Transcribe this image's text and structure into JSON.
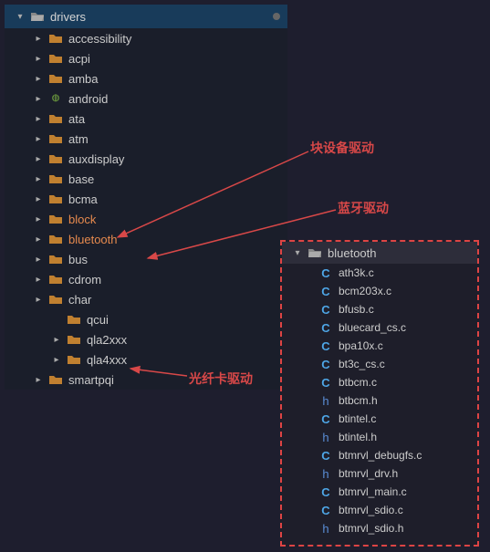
{
  "tree": {
    "root": "drivers",
    "items": [
      {
        "label": "accessibility",
        "icon": "folder"
      },
      {
        "label": "acpi",
        "icon": "folder"
      },
      {
        "label": "amba",
        "icon": "folder"
      },
      {
        "label": "android",
        "icon": "android"
      },
      {
        "label": "ata",
        "icon": "folder"
      },
      {
        "label": "atm",
        "icon": "folder"
      },
      {
        "label": "auxdisplay",
        "icon": "folder"
      },
      {
        "label": "base",
        "icon": "folder"
      },
      {
        "label": "bcma",
        "icon": "folder"
      },
      {
        "label": "block",
        "icon": "folder",
        "hl": true
      },
      {
        "label": "bluetooth",
        "icon": "folder",
        "hl": true
      },
      {
        "label": "bus",
        "icon": "folder"
      },
      {
        "label": "cdrom",
        "icon": "folder"
      },
      {
        "label": "char",
        "icon": "folder"
      }
    ],
    "sub": [
      {
        "label": "qla2xxx",
        "icon": "folder"
      },
      {
        "label": "qla4xxx",
        "icon": "folder"
      }
    ],
    "sub2": [
      {
        "label": "smartpqi",
        "icon": "folder"
      }
    ],
    "cutoff": "qcui"
  },
  "popup": {
    "root": "bluetooth",
    "files": [
      {
        "name": "ath3k.c",
        "type": "c"
      },
      {
        "name": "bcm203x.c",
        "type": "c"
      },
      {
        "name": "bfusb.c",
        "type": "c"
      },
      {
        "name": "bluecard_cs.c",
        "type": "c"
      },
      {
        "name": "bpa10x.c",
        "type": "c"
      },
      {
        "name": "bt3c_cs.c",
        "type": "c"
      },
      {
        "name": "btbcm.c",
        "type": "c"
      },
      {
        "name": "btbcm.h",
        "type": "h"
      },
      {
        "name": "btintel.c",
        "type": "c"
      },
      {
        "name": "btintel.h",
        "type": "h"
      },
      {
        "name": "btmrvl_debugfs.c",
        "type": "c"
      },
      {
        "name": "btmrvl_drv.h",
        "type": "h"
      },
      {
        "name": "btmrvl_main.c",
        "type": "c"
      },
      {
        "name": "btmrvl_sdio.c",
        "type": "c"
      },
      {
        "name": "btmrvl_sdio.h",
        "type": "h"
      }
    ]
  },
  "annotations": {
    "block": "块设备驱动",
    "bluetooth": "蓝牙驱动",
    "fiber": "光纤卡驱动"
  },
  "colors": {
    "highlight": "#e78a4e",
    "annotation": "#d84848",
    "folder_orange": "#c08030",
    "folder_gray": "#888",
    "c_icon": "#4ea6e6",
    "h_icon": "#5a8dd6"
  }
}
